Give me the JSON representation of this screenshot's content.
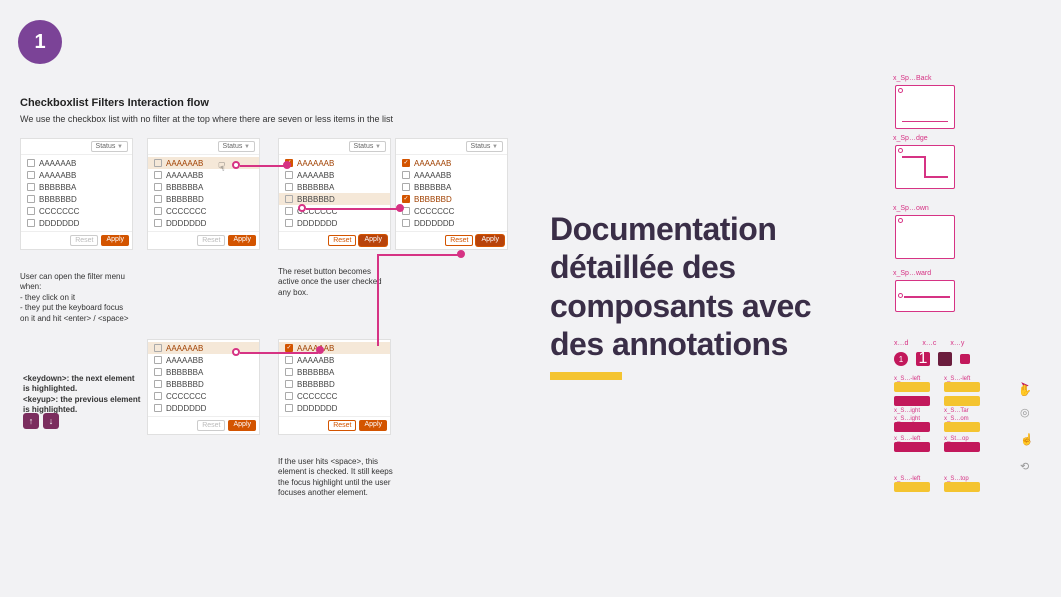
{
  "badge": "1",
  "doc": {
    "title": "Checkboxlist Filters Interaction flow",
    "subtitle": "We use the checkbox list with no filter at the top where there are seven or less items in the list"
  },
  "status_label": "Status",
  "items": [
    "AAAAAAB",
    "AAAAABB",
    "BBBBBBA",
    "BBBBBBD",
    "CCCCCCC",
    "DDDDDDD"
  ],
  "btn_reset": "Reset",
  "btn_apply": "Apply",
  "notes": {
    "n1": "User can open the filter menu when:\n- they click on it\n- they put the keyboard focus on it and hit <enter> / <space>",
    "n2": "The reset button becomes active once the user checked any box.",
    "n3": "<keydown>: the next element is highlighted.\n<keyup>: the previous element is highlighted.",
    "n4": "If the user hits <space>, this element is checked. It still keeps the focus highlight until the user focuses another element."
  },
  "center_heading": "Documentation détaillée des composants avec des annotations",
  "thumbs": {
    "t1": "x_Sp…Back",
    "t2": "x_Sp…dge",
    "t3": "x_Sp…own",
    "t4": "x_Sp…ward"
  },
  "minirow": {
    "a": "x…d",
    "b": "x…c",
    "c": "x…y",
    "val": "1"
  },
  "specs": {
    "s1": "x_S…-left",
    "s2": "x_S…-left",
    "s3": "x_S…ight",
    "s4": "x_S…Tar",
    "s5": "x_S…ight",
    "s6": "x_S…om",
    "s7": "x_S…-left",
    "s8": "x_St…op",
    "s9": "x_S…-left",
    "s10": "x_S…top"
  }
}
